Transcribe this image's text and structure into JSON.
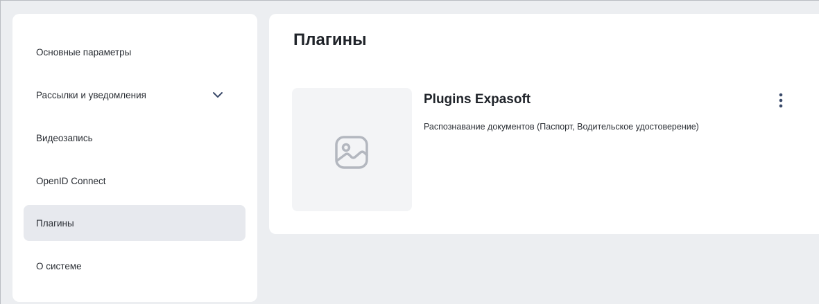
{
  "sidebar": {
    "items": [
      {
        "label": "Основные параметры"
      },
      {
        "label": "Рассылки и уведомления",
        "icon": "chevron-down-icon"
      },
      {
        "label": "Видеозапись"
      },
      {
        "label": "OpenID Connect"
      },
      {
        "label": "Плагины",
        "active": true
      },
      {
        "label": "О системе"
      }
    ]
  },
  "main": {
    "title": "Плагины",
    "plugin": {
      "name": "Plugins Expasoft",
      "description": "Распознавание документов (Паспорт, Водительское удостоверение)",
      "thumbnail_icon": "image-placeholder-icon",
      "menu_icon": "more-vertical-icon"
    }
  },
  "colors": {
    "background": "#eceef1",
    "card": "#ffffff",
    "active_item": "#e7e9ee",
    "accent": "#3a4a6a"
  }
}
